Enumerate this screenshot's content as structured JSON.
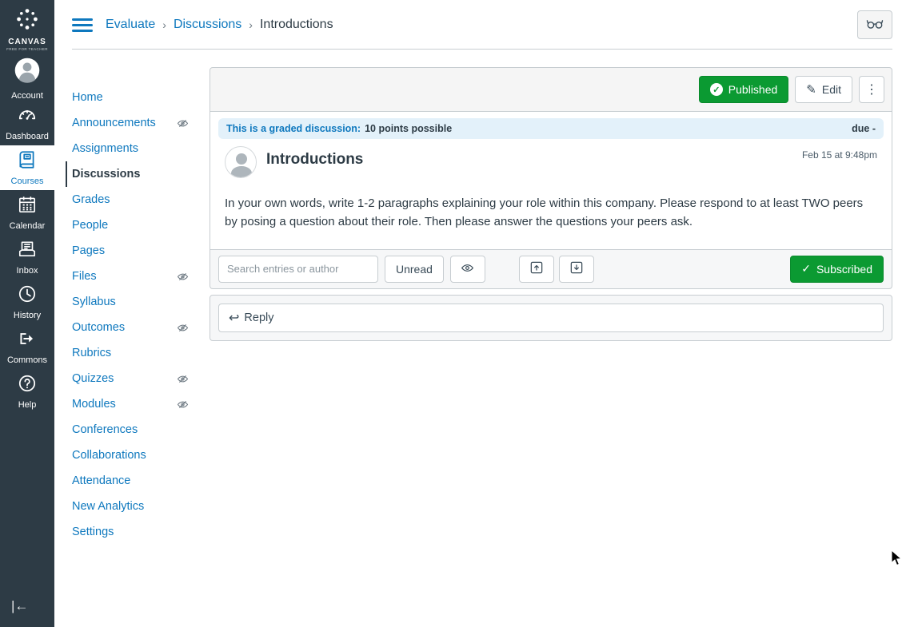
{
  "colors": {
    "link_blue": "#0E78BE",
    "published_green": "#0B9A32",
    "sidebar_bg": "#2D3B45",
    "banner_bg": "#E3F1FA",
    "border": "#C7CDD1"
  },
  "icons": {
    "kebab": "⋮",
    "pencil": "✎",
    "check": "✓",
    "reply": "↩",
    "collapse_nav": "|←",
    "breadcrumb_separator": "›"
  },
  "global_nav": {
    "logo_title": "CANVAS",
    "logo_subtitle": "FREE FOR TEACHER",
    "items": [
      {
        "label": "Account"
      },
      {
        "label": "Dashboard"
      },
      {
        "label": "Courses",
        "active": true
      },
      {
        "label": "Calendar"
      },
      {
        "label": "Inbox"
      },
      {
        "label": "History"
      },
      {
        "label": "Commons"
      },
      {
        "label": "Help"
      }
    ]
  },
  "breadcrumb": {
    "items": [
      {
        "label": "Evaluate"
      },
      {
        "label": "Discussions"
      },
      {
        "label": "Introductions"
      }
    ]
  },
  "course_nav": {
    "items": [
      {
        "label": "Home"
      },
      {
        "label": "Announcements",
        "hidden": true
      },
      {
        "label": "Assignments"
      },
      {
        "label": "Discussions",
        "active": true
      },
      {
        "label": "Grades"
      },
      {
        "label": "People"
      },
      {
        "label": "Pages"
      },
      {
        "label": "Files",
        "hidden": true
      },
      {
        "label": "Syllabus"
      },
      {
        "label": "Outcomes",
        "hidden": true
      },
      {
        "label": "Rubrics"
      },
      {
        "label": "Quizzes",
        "hidden": true
      },
      {
        "label": "Modules",
        "hidden": true
      },
      {
        "label": "Conferences"
      },
      {
        "label": "Collaborations"
      },
      {
        "label": "Attendance"
      },
      {
        "label": "New Analytics"
      },
      {
        "label": "Settings"
      }
    ]
  },
  "discussion": {
    "status_label": "Published",
    "edit_label": "Edit",
    "graded_notice": "This is a graded discussion:",
    "points_text": "10 points possible",
    "due_text": "due -",
    "title": "Introductions",
    "date": "Feb 15 at 9:48pm",
    "body": "In your own words, write 1-2 paragraphs explaining your role within this company. Please respond to at least TWO peers by posing a question about their role. Then please answer the questions your peers ask.",
    "toolbar": {
      "search_placeholder": "Search entries or author",
      "unread_label": "Unread",
      "subscribed_label": "Subscribed"
    },
    "reply_label": "Reply"
  }
}
